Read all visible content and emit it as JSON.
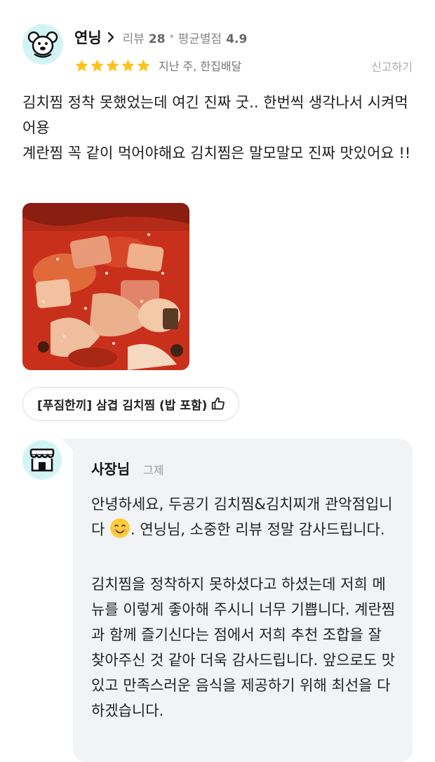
{
  "reviewer": {
    "nickname": "연닝",
    "review_count_label": "리뷰",
    "review_count": "28",
    "avg_rating_label": "평균별점",
    "avg_rating": "4.9",
    "rating_stars": 5,
    "order_info": "지난 주, 한집배달",
    "report_label": "신고하기",
    "avatar_icon": "mouse-face-icon",
    "avatar_bg": "#d3f4f4"
  },
  "review": {
    "lines": [
      "김치찜 정착 못했었는데 여긴 진짜 굿.. 한번씩 생각나서 시켜먹어용",
      "계란찜 꼭 같이 먹어야해요 김치찜은 말모말모 진짜 맛있어요 !!"
    ]
  },
  "photo": {
    "alt": "kimchi-jjim-photo"
  },
  "menu_chip": {
    "label": "[푸짐한끼] 삼겹 김치찜 (밥 포함)",
    "icon": "thumbs-up-icon"
  },
  "owner_reply": {
    "name": "사장님",
    "date": "그제",
    "avatar_icon": "storefront-icon",
    "para1_before": "안녕하세요, 두공기 김치찜&김치찌개 관악점입니다 ",
    "para1_emoji": "smiling-face-emoji",
    "para1_after": ". 연닝님, 소중한 리뷰 정말 감사드립니다.",
    "para2": "김치찜을 정착하지 못하셨다고 하셨는데 저희 메뉴를 이렇게 좋아해 주시니 너무 기쁩니다. 계란찜과 함께 즐기신다는 점에서 저희 추천 조합을 잘 찾아주신 것 같아 더욱 감사드립니다. 앞으로도 맛있고 만족스러운 음식을 제공하기 위해 최선을 다하겠습니다."
  },
  "colors": {
    "star": "#ffc21c",
    "bubble_bg": "#f2f3f5",
    "avatar_bg": "#d3f4f4",
    "muted_text": "#888888"
  }
}
